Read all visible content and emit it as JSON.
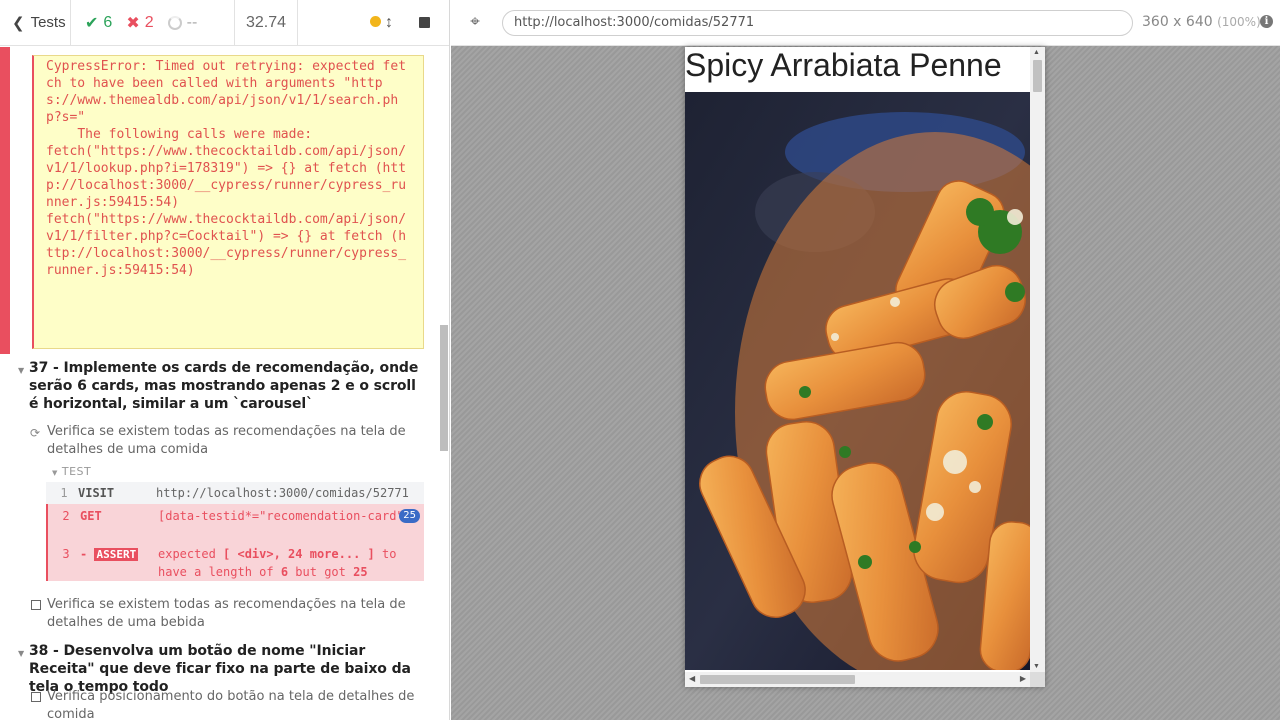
{
  "stats": {
    "tests_label": "Tests",
    "passed": "6",
    "failed": "2",
    "pending": "--",
    "duration": "32.74"
  },
  "error": {
    "lines": [
      "CypressError: Timed out retrying: expected fetch to have been called with arguments \"https://www.themealdb.com/api/json/v1/1/search.php?s=\"",
      "",
      "    The following calls were made:",
      "",
      "",
      "fetch(\"https://www.thecocktaildb.com/api/json/v1/1/lookup.php?i=178319\") => {} at fetch (http://localhost:3000/__cypress/runner/cypress_runner.js:59415:54)",
      "",
      "fetch(\"https://www.thecocktaildb.com/api/json/v1/1/filter.php?c=Cocktail\") => {} at fetch (http://localhost:3000/__cypress/runner/cypress_runner.js:59415:54)"
    ]
  },
  "suites": [
    {
      "title": "37 - Implemente os cards de recomendação, onde serão 6 cards, mas mostrando apenas 2 e o scroll é horizontal, similar a um `carousel`",
      "tests": [
        "Verifica se existem todas as recomendações na tela de detalhes de uma comida",
        "Verifica se existem todas as recomendações na tela de detalhes de uma bebida"
      ]
    },
    {
      "title": "38 - Desenvolva um botão de nome \"Iniciar Receita\" que deve ficar fixo na parte de baixo da tela o tempo todo",
      "tests": [
        "Verifica posicionamento do botão na tela de detalhes de comida"
      ]
    }
  ],
  "test_header": "TEST",
  "commands": [
    {
      "num": "1",
      "name": "VISIT",
      "message": "http://localhost:3000/comidas/52771"
    },
    {
      "num": "2",
      "name": "GET",
      "message": "[data-testid*=\"recomendation-card\"]",
      "badge": "25"
    },
    {
      "num": "3",
      "name": "ASSERT",
      "prefix": "-",
      "msg_expected": "expected",
      "msg_subject": "[ <div>, 24 more... ]",
      "msg_to": "to have a length of",
      "msg_len": "6",
      "msg_but": "but got",
      "msg_got": "25"
    }
  ],
  "aut": {
    "url": "http://localhost:3000/comidas/52771",
    "viewport": "360 x 640",
    "zoom": "(100%)",
    "page_title": "Spicy Arrabiata Penne"
  },
  "colors": {
    "pass": "#2ca35a",
    "fail": "#e94f5f",
    "error_bg": "#fefec8",
    "badge": "#3a6bc6"
  },
  "icons": [
    "chevron-left-icon",
    "check-icon",
    "x-icon",
    "spinner-icon",
    "dot-icon",
    "arrows-icon",
    "stop-icon",
    "crosshair-icon",
    "info-icon",
    "refresh-icon",
    "checkbox-icon"
  ]
}
